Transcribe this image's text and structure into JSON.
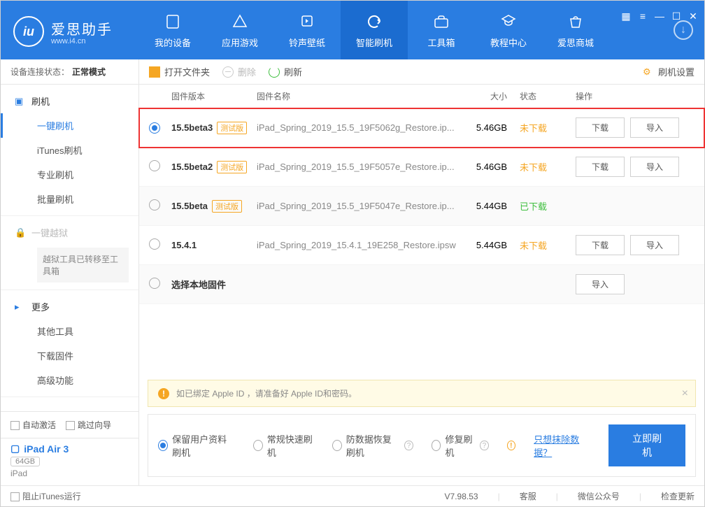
{
  "window": {
    "controls": [
      "grid",
      "skin",
      "min",
      "max",
      "close"
    ]
  },
  "brand": {
    "name": "爱思助手",
    "url": "www.i4.cn"
  },
  "nav": {
    "items": [
      {
        "id": "device",
        "label": "我的设备"
      },
      {
        "id": "apps",
        "label": "应用游戏"
      },
      {
        "id": "ring",
        "label": "铃声壁纸"
      },
      {
        "id": "flash",
        "label": "智能刷机"
      },
      {
        "id": "tools",
        "label": "工具箱"
      },
      {
        "id": "tutorial",
        "label": "教程中心"
      },
      {
        "id": "store",
        "label": "爱思商城"
      }
    ],
    "active": "flash"
  },
  "connection": {
    "label": "设备连接状态：",
    "value": "正常模式"
  },
  "sidebar": {
    "groups": [
      {
        "head": "刷机",
        "items": [
          {
            "id": "oneclick",
            "label": "一键刷机",
            "active": true
          },
          {
            "id": "itunes",
            "label": "iTunes刷机"
          },
          {
            "id": "pro",
            "label": "专业刷机"
          },
          {
            "id": "batch",
            "label": "批量刷机"
          }
        ]
      },
      {
        "head": "一键越狱",
        "disabled": true,
        "note": "越狱工具已转移至工具箱"
      },
      {
        "head": "更多",
        "items": [
          {
            "id": "other",
            "label": "其他工具"
          },
          {
            "id": "dlfw",
            "label": "下载固件"
          },
          {
            "id": "adv",
            "label": "高级功能"
          }
        ]
      }
    ],
    "autoActivate": "自动激活",
    "skipGuide": "跳过向导",
    "device": {
      "name": "iPad Air 3",
      "capacity": "64GB",
      "type": "iPad"
    }
  },
  "toolbar": {
    "openFolder": "打开文件夹",
    "delete": "删除",
    "refresh": "刷新",
    "settings": "刷机设置"
  },
  "columns": {
    "version": "固件版本",
    "name": "固件名称",
    "size": "大小",
    "status": "状态",
    "ops": "操作"
  },
  "firmwares": [
    {
      "selected": true,
      "version": "15.5beta3",
      "beta": true,
      "name": "iPad_Spring_2019_15.5_19F5062g_Restore.ip...",
      "size": "5.46GB",
      "status": "未下载",
      "statusClass": "st-orange",
      "download": true,
      "import": true,
      "highlight": true
    },
    {
      "selected": false,
      "version": "15.5beta2",
      "beta": true,
      "name": "iPad_Spring_2019_15.5_19F5057e_Restore.ip...",
      "size": "5.46GB",
      "status": "未下载",
      "statusClass": "st-orange",
      "download": true,
      "import": true
    },
    {
      "selected": false,
      "version": "15.5beta",
      "beta": true,
      "name": "iPad_Spring_2019_15.5_19F5047e_Restore.ip...",
      "size": "5.44GB",
      "status": "已下载",
      "statusClass": "st-green",
      "download": false,
      "import": false,
      "alt": true
    },
    {
      "selected": false,
      "version": "15.4.1",
      "beta": false,
      "name": "iPad_Spring_2019_15.4.1_19E258_Restore.ipsw",
      "size": "5.44GB",
      "status": "未下载",
      "statusClass": "st-orange",
      "download": true,
      "import": true
    },
    {
      "selected": false,
      "version": "选择本地固件",
      "beta": false,
      "name": "",
      "size": "",
      "status": "",
      "statusClass": "",
      "download": false,
      "import": true,
      "local": true,
      "alt": true
    }
  ],
  "betaBadge": "测试版",
  "ops": {
    "download": "下载",
    "import": "导入"
  },
  "warning": "如已绑定 Apple ID ，请准备好 Apple ID和密码。",
  "modes": {
    "items": [
      {
        "id": "keep",
        "label": "保留用户资料刷机",
        "selected": true
      },
      {
        "id": "fast",
        "label": "常规快速刷机",
        "selected": false
      },
      {
        "id": "anti",
        "label": "防数据恢复刷机",
        "selected": false,
        "q": true
      },
      {
        "id": "repair",
        "label": "修复刷机",
        "selected": false,
        "q": true
      }
    ],
    "eraseLink": "只想抹除数据？",
    "action": "立即刷机"
  },
  "statusbar": {
    "blockItunes": "阻止iTunes运行",
    "version": "V7.98.53",
    "service": "客服",
    "wechat": "微信公众号",
    "update": "检查更新"
  }
}
